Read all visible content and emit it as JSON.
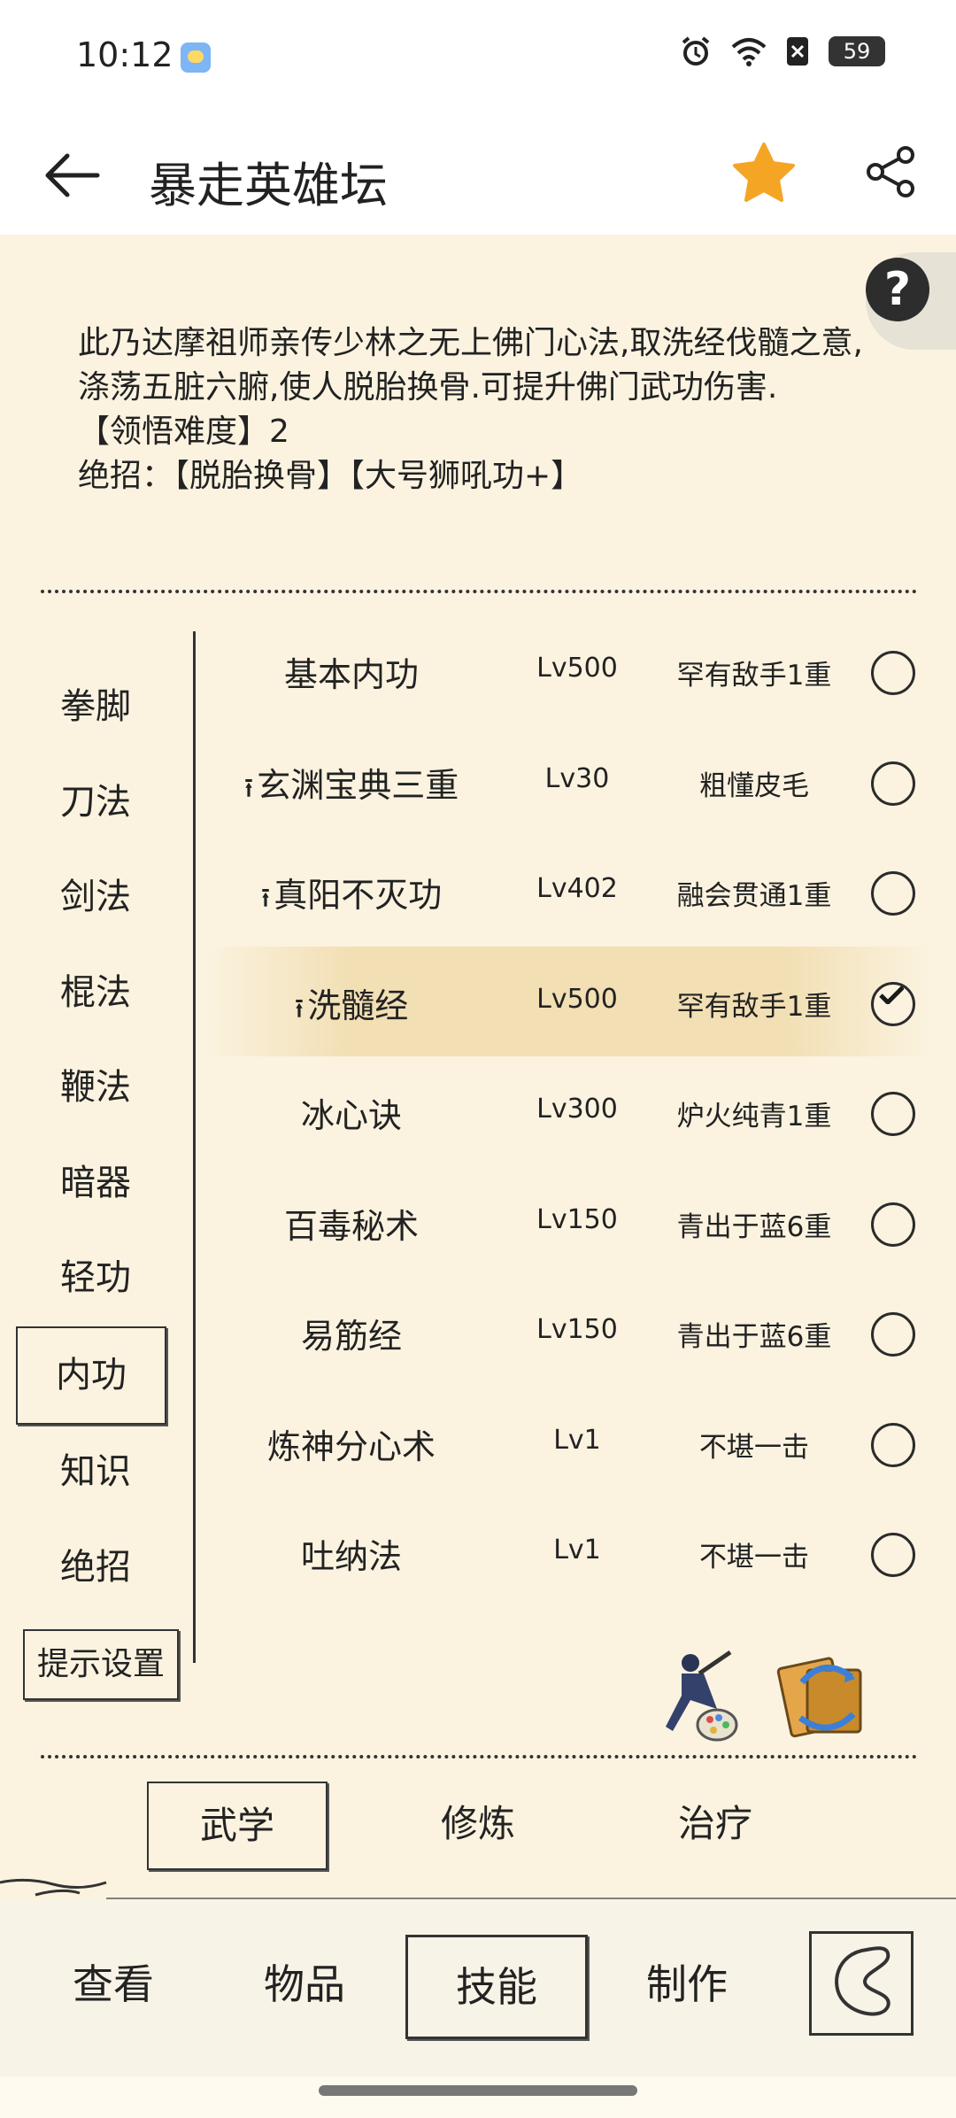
{
  "status_bar": {
    "time": "10:12",
    "battery": "59"
  },
  "header": {
    "title": "暴走英雄坛"
  },
  "description": {
    "text": "此乃达摩祖师亲传少林之无上佛门心法,取洗经伐髓之意,涤荡五脏六腑,使人脱胎换骨.可提升佛门武功伤害.",
    "difficulty": "【领悟难度】2",
    "ultimate": "绝招：【脱胎换骨】【大号狮吼功+】"
  },
  "sidebar": {
    "items": [
      "拳脚",
      "刀法",
      "剑法",
      "棍法",
      "鞭法",
      "暗器",
      "轻功",
      "内功",
      "知识",
      "绝招"
    ],
    "selected": "内功",
    "hint_button": "提示设置"
  },
  "skills": [
    {
      "name": "基本内功",
      "level": "Lv500",
      "rank": "罕有敌手1重",
      "arrow": false,
      "checked": false
    },
    {
      "name": "玄渊宝典三重",
      "level": "Lv30",
      "rank": "粗懂皮毛",
      "arrow": true,
      "checked": false
    },
    {
      "name": "真阳不灭功",
      "level": "Lv402",
      "rank": "融会贯通1重",
      "arrow": true,
      "checked": false
    },
    {
      "name": "洗髓经",
      "level": "Lv500",
      "rank": "罕有敌手1重",
      "arrow": true,
      "checked": true
    },
    {
      "name": "冰心诀",
      "level": "Lv300",
      "rank": "炉火纯青1重",
      "arrow": false,
      "checked": false
    },
    {
      "name": "百毒秘术",
      "level": "Lv150",
      "rank": "青出于蓝6重",
      "arrow": false,
      "checked": false
    },
    {
      "name": "易筋经",
      "level": "Lv150",
      "rank": "青出于蓝6重",
      "arrow": false,
      "checked": false
    },
    {
      "name": "炼神分心术",
      "level": "Lv1",
      "rank": "不堪一击",
      "arrow": false,
      "checked": false
    },
    {
      "name": "吐纳法",
      "level": "Lv1",
      "rank": "不堪一击",
      "arrow": false,
      "checked": false
    }
  ],
  "sub_tabs": [
    "武学",
    "修炼",
    "治疗"
  ],
  "sub_tab_selected": "武学",
  "bottom_tabs": [
    "查看",
    "物品",
    "技能",
    "制作"
  ],
  "bottom_tab_selected": "技能",
  "icons": {
    "star_color": "#f5a524"
  }
}
